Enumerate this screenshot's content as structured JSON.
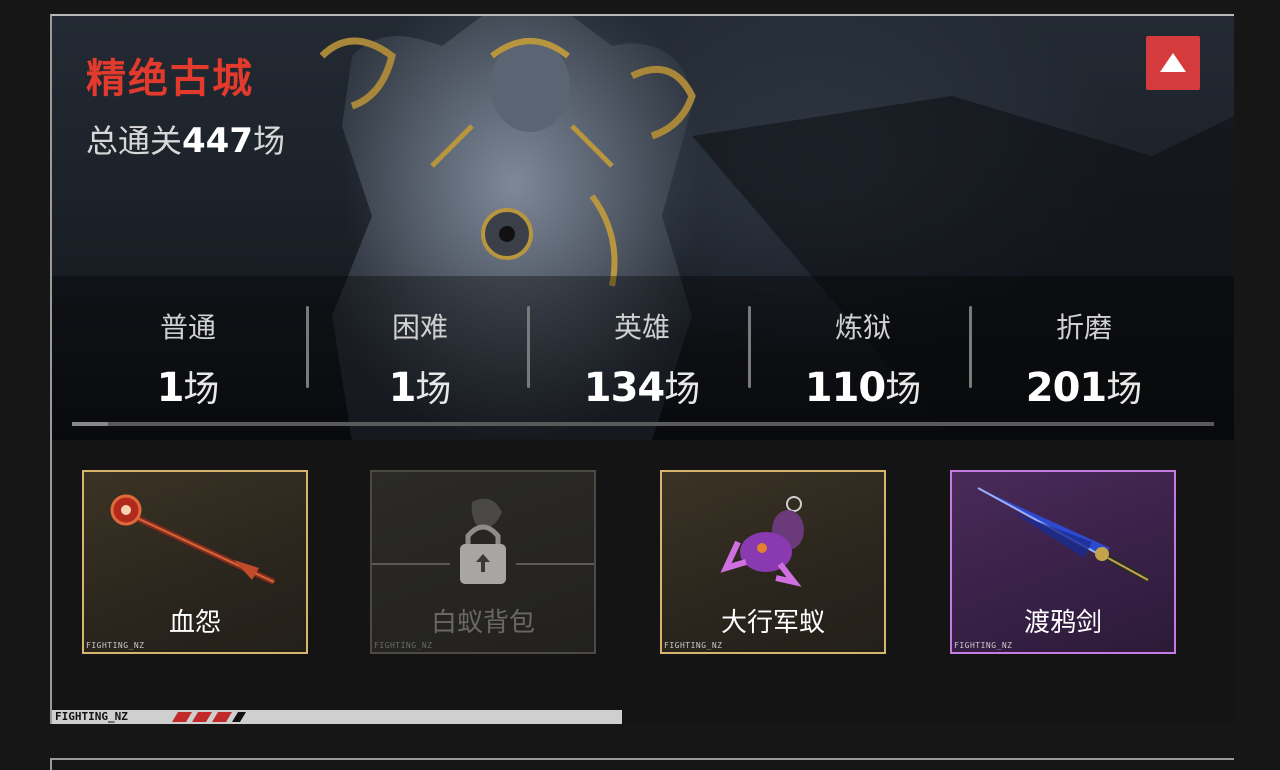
{
  "header": {
    "title": "精绝古城",
    "total_prefix": "总通关",
    "total_count": "447",
    "total_unit": "场"
  },
  "stats": [
    {
      "label": "普通",
      "value": "1",
      "unit": "场"
    },
    {
      "label": "困难",
      "value": "1",
      "unit": "场"
    },
    {
      "label": "英雄",
      "value": "134",
      "unit": "场"
    },
    {
      "label": "炼狱",
      "value": "110",
      "unit": "场"
    },
    {
      "label": "折磨",
      "value": "201",
      "unit": "场"
    }
  ],
  "rewards": [
    {
      "name": "血怨",
      "tag": "FIGHTING_NZ",
      "locked": false,
      "rarity": "gold"
    },
    {
      "name": "白蚁背包",
      "tag": "FIGHTING_NZ",
      "locked": true,
      "rarity": "locked"
    },
    {
      "name": "大行军蚁",
      "tag": "FIGHTING_NZ",
      "locked": false,
      "rarity": "gold"
    },
    {
      "name": "渡鸦剑",
      "tag": "FIGHTING_NZ",
      "locked": false,
      "rarity": "purple"
    }
  ],
  "footer": {
    "tag": "FIGHTING_NZ"
  },
  "colors": {
    "title_red": "#e23a2c",
    "button_red": "#d53a3d",
    "gold_border": "#d8b56c",
    "purple_border": "#c67be0"
  },
  "icons": {
    "collapse": "triangle-up-icon",
    "lock": "padlock-icon"
  }
}
